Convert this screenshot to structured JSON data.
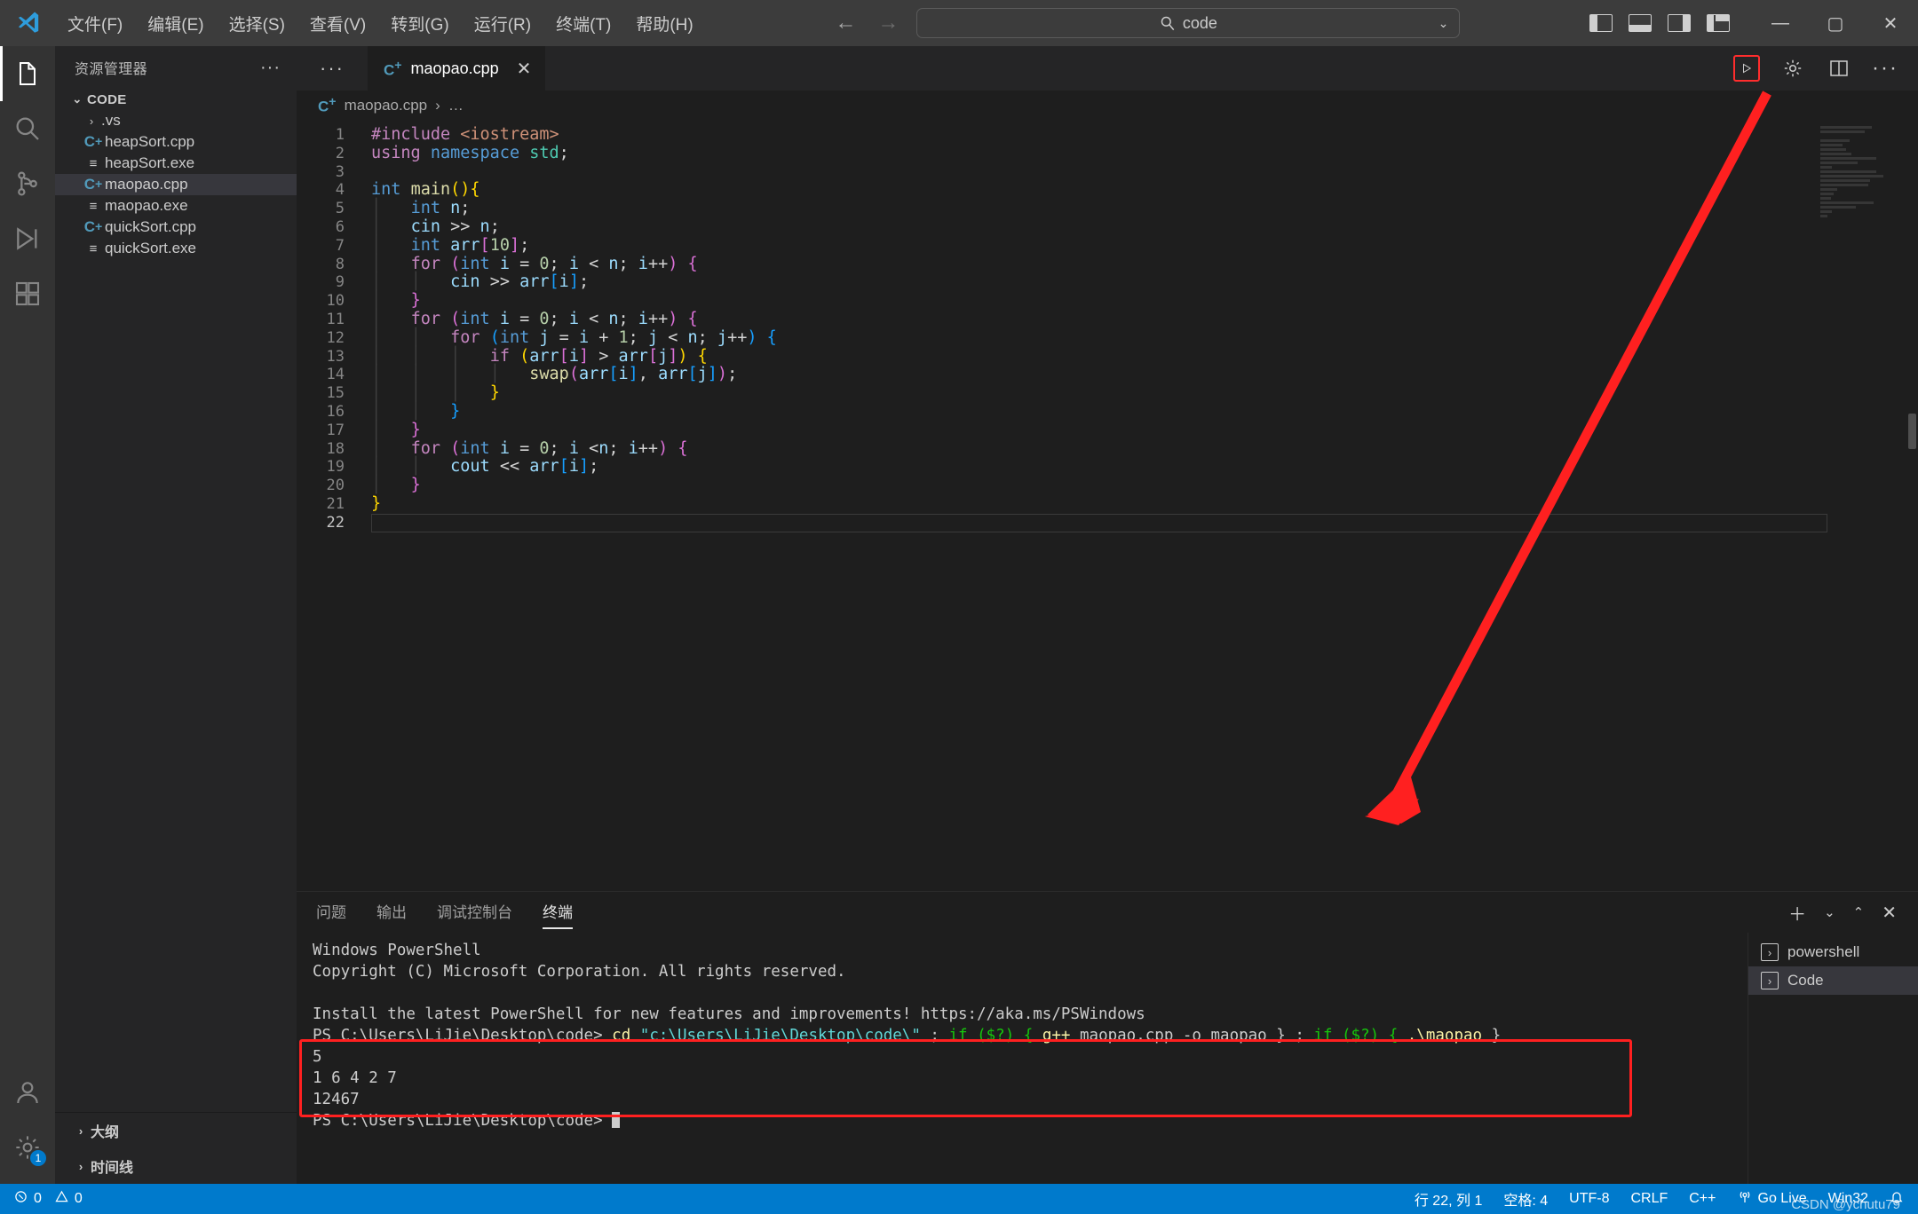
{
  "titlebar": {
    "logo": "vscode-logo",
    "menus": [
      "文件(F)",
      "编辑(E)",
      "选择(S)",
      "查看(V)",
      "转到(G)",
      "运行(R)",
      "终端(T)",
      "帮助(H)"
    ],
    "nav_back": "←",
    "nav_forward": "→",
    "search_value": "code",
    "search_icon": "search-icon",
    "search_caret": "⌄",
    "layout_icons": [
      "toggle-primary-sidebar",
      "toggle-panel",
      "toggle-secondary-sidebar",
      "customize-layout"
    ],
    "window_minimize": "—",
    "window_maximize": "▢",
    "window_close": "✕"
  },
  "activitybar": {
    "items": [
      {
        "name": "explorer",
        "icon": "files-icon",
        "active": true
      },
      {
        "name": "search",
        "icon": "search-icon",
        "active": false
      },
      {
        "name": "source-control",
        "icon": "source-control-icon",
        "active": false
      },
      {
        "name": "run-and-debug",
        "icon": "run-debug-icon",
        "active": false
      },
      {
        "name": "extensions",
        "icon": "extensions-icon",
        "active": false
      }
    ],
    "account_icon": "account-icon",
    "settings_icon": "gear-icon",
    "settings_badge": "1"
  },
  "sidebar": {
    "title": "资源管理器",
    "more_actions": "···",
    "root": "CODE",
    "root_chevron": "⌄",
    "items": [
      {
        "label": ".vs",
        "icon": "folder-chevron",
        "type": "folder",
        "selected": false
      },
      {
        "label": "heapSort.cpp",
        "icon": "cpp-file-icon",
        "type": "cpp",
        "selected": false
      },
      {
        "label": "heapSort.exe",
        "icon": "binary-file-icon",
        "type": "exe",
        "selected": false
      },
      {
        "label": "maopao.cpp",
        "icon": "cpp-file-icon",
        "type": "cpp",
        "selected": true
      },
      {
        "label": "maopao.exe",
        "icon": "binary-file-icon",
        "type": "exe",
        "selected": false
      },
      {
        "label": "quickSort.cpp",
        "icon": "cpp-file-icon",
        "type": "cpp",
        "selected": false
      },
      {
        "label": "quickSort.exe",
        "icon": "binary-file-icon",
        "type": "exe",
        "selected": false
      }
    ],
    "sections": [
      {
        "label": "大纲",
        "chevron": "›"
      },
      {
        "label": "时间线",
        "chevron": "›"
      }
    ]
  },
  "editor": {
    "tab_more": "···",
    "tab_label": "maopao.cpp",
    "tab_icon": "cpp-file-icon",
    "tab_close": "✕",
    "actions": [
      {
        "name": "run-code-button",
        "icon": "play-icon",
        "highlight": true
      },
      {
        "name": "settings-button",
        "icon": "gear-icon",
        "highlight": false
      },
      {
        "name": "split-editor-button",
        "icon": "split-editor-icon",
        "highlight": false
      },
      {
        "name": "more-actions-button",
        "icon": "ellipsis-icon",
        "highlight": false
      }
    ],
    "breadcrumb": [
      "maopao.cpp",
      "…"
    ],
    "breadcrumb_icon": "cpp-file-icon",
    "breadcrumb_sep": "›",
    "total_lines": 22,
    "current_line": 22,
    "lines": [
      {
        "n": 1,
        "text": "#include <iostream>"
      },
      {
        "n": 2,
        "text": "using namespace std;"
      },
      {
        "n": 3,
        "text": ""
      },
      {
        "n": 4,
        "text": "int main(){"
      },
      {
        "n": 5,
        "text": "    int n;"
      },
      {
        "n": 6,
        "text": "    cin >> n;"
      },
      {
        "n": 7,
        "text": "    int arr[10];"
      },
      {
        "n": 8,
        "text": "    for (int i = 0; i < n; i++) {"
      },
      {
        "n": 9,
        "text": "        cin >> arr[i];"
      },
      {
        "n": 10,
        "text": "    }"
      },
      {
        "n": 11,
        "text": "    for (int i = 0; i < n; i++) {"
      },
      {
        "n": 12,
        "text": "        for (int j = i + 1; j < n; j++) {"
      },
      {
        "n": 13,
        "text": "            if (arr[i] > arr[j]) {"
      },
      {
        "n": 14,
        "text": "                swap(arr[i], arr[j]);"
      },
      {
        "n": 15,
        "text": "            }"
      },
      {
        "n": 16,
        "text": "        }"
      },
      {
        "n": 17,
        "text": "    }"
      },
      {
        "n": 18,
        "text": "    for (int i = 0; i <n; i++) {"
      },
      {
        "n": 19,
        "text": "        cout << arr[i];"
      },
      {
        "n": 20,
        "text": "    }"
      },
      {
        "n": 21,
        "text": "}"
      },
      {
        "n": 22,
        "text": ""
      }
    ]
  },
  "panel": {
    "tabs": [
      {
        "label": "问题",
        "active": false
      },
      {
        "label": "输出",
        "active": false
      },
      {
        "label": "调试控制台",
        "active": false
      },
      {
        "label": "终端",
        "active": true
      }
    ],
    "actions": [
      "new-terminal-plus",
      "terminal-dropdown-chevron",
      "maximize-panel-chevron",
      "close-panel-x"
    ],
    "terminal_lines": [
      "Windows PowerShell",
      "Copyright (C) Microsoft Corporation. All rights reserved.",
      "",
      "Install the latest PowerShell for new features and improvements! https://aka.ms/PSWindows",
      ""
    ],
    "command": {
      "prompt": "PS C:\\Users\\LiJie\\Desktop\\code>",
      "cd": "cd",
      "path_arg": "\"c:\\Users\\LiJie\\Desktop\\code\\\"",
      "sep1": " ; ",
      "if1": "if ($?) {",
      "gpp": "g++",
      "compile_args": " maopao.cpp -o maopao }",
      "sep2": " ; ",
      "if2": "if ($?) {",
      "run_arg": " .\\maopao",
      "end": " }"
    },
    "output_lines": [
      "5",
      "1 6 4 2 7",
      "12467"
    ],
    "final_prompt": "PS C:\\Users\\LiJie\\Desktop\\code>",
    "terminal_list": [
      {
        "label": "powershell",
        "icon": "terminal-icon",
        "selected": false
      },
      {
        "label": "Code",
        "icon": "terminal-icon",
        "selected": true
      }
    ]
  },
  "statusbar": {
    "errors_icon": "error-icon",
    "errors": "0",
    "warnings_icon": "warning-icon",
    "warnings": "0",
    "cursor_position": "行 22, 列 1",
    "indentation": "空格: 4",
    "encoding": "UTF-8",
    "eol": "CRLF",
    "language": "C++",
    "golive_icon": "broadcast-icon",
    "golive": "Go Live",
    "platform": "Win32",
    "bell_icon": "bell-icon",
    "watermark": "CSDN @ychutu79"
  },
  "colors": {
    "accent": "#007acc",
    "annotation_red": "#ff2020",
    "titlebar_bg": "#3c3c3c",
    "sidebar_bg": "#252526",
    "editor_bg": "#1e1e1e",
    "activity_bg": "#333333"
  }
}
